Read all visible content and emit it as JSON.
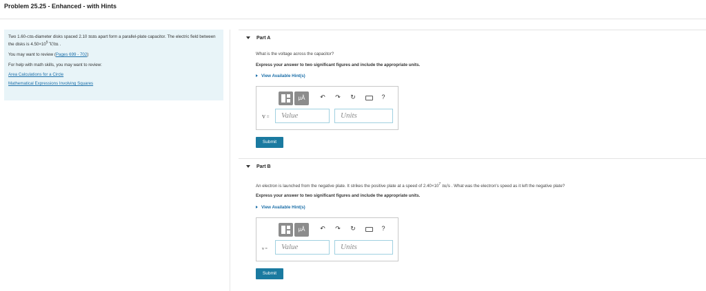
{
  "page": {
    "title": "Problem 25.25 - Enhanced - with Hints"
  },
  "intro": {
    "text1_pre": "Two 1.60-",
    "text1_unit1": "cm",
    "text1_mid": "-diameter disks spaced 2.10 ",
    "text1_unit2": "mm",
    "text1_post": " apart form a parallel-plate capacitor. The electric field between the disks is 4.50×10",
    "text1_exp": "5",
    "text1_unit3": " V/m",
    "text1_end": " .",
    "review_pre": "You may want to review (",
    "review_link": "Pages 699 - 702",
    "review_post": ")",
    "help_text": "For help with math skills, you may want to review:",
    "link1": "Area Calculations for a Circle",
    "link2": "Mathematical Expressions Involving Squares"
  },
  "partA": {
    "header": "Part A",
    "question": "What is the voltage across the capacitor?",
    "instruction": "Express your answer to two significant figures and include the appropriate units.",
    "hint_label": "View Available Hint(s)",
    "var_label": "V =",
    "value_placeholder": "Value",
    "units_placeholder": "Units",
    "submit_label": "Submit"
  },
  "partB": {
    "header": "Part B",
    "question_pre": "An electron is launched from the negative plate. It strikes the positive plate at a speed of 2.40×10",
    "question_exp": "7",
    "question_unit": " m/s",
    "question_post": " . What was the electron's speed as it left the negative plate?",
    "instruction": "Express your answer to two significant figures and include the appropriate units.",
    "hint_label": "View Available Hint(s)",
    "var_label": "v =",
    "value_placeholder": "Value",
    "units_placeholder": "Units",
    "submit_label": "Submit"
  },
  "toolbar": {
    "units_button": "μÅ",
    "help_glyph": "?",
    "icons": [
      "templates-icon",
      "units-icon",
      "undo-icon",
      "redo-icon",
      "reset-icon",
      "keyboard-icon",
      "help-icon"
    ]
  }
}
